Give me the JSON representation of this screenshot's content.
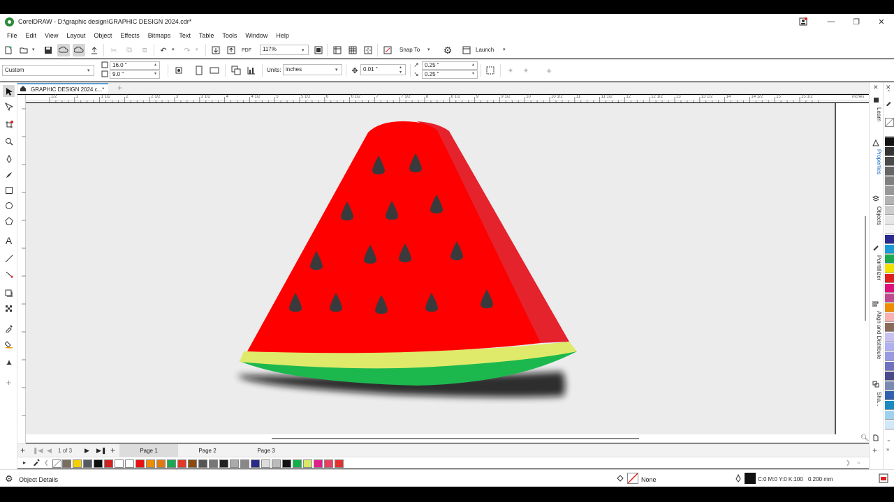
{
  "window": {
    "title": "CorelDRAW - D:\\graphic design\\GRAPHIC DESIGN 2024.cdr*"
  },
  "menu": [
    "File",
    "Edit",
    "View",
    "Layout",
    "Object",
    "Effects",
    "Bitmaps",
    "Text",
    "Table",
    "Tools",
    "Window",
    "Help"
  ],
  "toolbar": {
    "zoom": "117%",
    "snap_label": "Snap To",
    "launch_label": "Launch"
  },
  "propbar": {
    "page_size": "Custom",
    "width": "16.0 \"",
    "height": "9.0 \"",
    "units_label": "Units:",
    "units": "inches",
    "nudge": "0.01 \"",
    "dup_x": "0.25 \"",
    "dup_y": "0.25 \""
  },
  "document": {
    "tab_label": "GRAPHIC DESIGN 2024.c...*"
  },
  "ruler": {
    "top_ticks": [
      "1/2",
      "1",
      "1 1/2",
      "2",
      "2 1/2",
      "3",
      "3 1/2",
      "4",
      "4 1/2",
      "5",
      "5 1/2",
      "6",
      "6 1/2",
      "7",
      "7 1/2",
      "8",
      "8 1/2",
      "9",
      "9 1/2",
      "10",
      "10 1/2",
      "11",
      "11 1/2",
      "12",
      "12 1/2",
      "13",
      "13 1/2",
      "14",
      "14 1/2",
      "15",
      "15 1/2"
    ],
    "units_label": "inches"
  },
  "pages": {
    "counter": "1",
    "of_label": "of",
    "total": "3",
    "tabs": [
      "Page 1",
      "Page 2",
      "Page 3"
    ]
  },
  "palette": [
    "#7a6e5e",
    "#f4d000",
    "#555a62",
    "#0e0e0e",
    "#d32020",
    "#ffffff",
    "#ffffff",
    "#e81010",
    "#f08c00",
    "#e07a10",
    "#1aa850",
    "#e03a2a",
    "#8a4a10",
    "#555555",
    "#777777",
    "#222222",
    "#aaaaaa",
    "#888888",
    "#2a2a8a",
    "#dddddd",
    "#bbbbbb",
    "#111111",
    "#12b04a",
    "#d8e86a",
    "#e0208a",
    "#e84060",
    "#e23030"
  ],
  "vpalette": [
    "#ffffff",
    "#111111",
    "#333333",
    "#4a4a4a",
    "#666666",
    "#808080",
    "#999999",
    "#b3b3b3",
    "#cccccc",
    "#e6e6e6",
    "#f5f5f5",
    "#2a2a90",
    "#1a9ad6",
    "#1aa850",
    "#f4e000",
    "#e02020",
    "#e0107a",
    "#c04a90",
    "#f08c00",
    "#f8b0b0",
    "#8a6a5a",
    "#c8c0f0",
    "#b0b0f0",
    "#9a9ae0",
    "#7070c0",
    "#4a4a8a",
    "#7a8ab0",
    "#3060b0",
    "#1a8ac0",
    "#a0d0f0",
    "#d0e8f8"
  ],
  "docker": [
    "Learn",
    "Properties",
    "Objects",
    "Pointillizer",
    "Align and Distribute",
    "Sha..."
  ],
  "status": {
    "object_details": "Object Details",
    "fill_none": "None",
    "outline_color": "C:0 M:0 Y:0 K:100",
    "outline_width": "0.200 mm"
  },
  "colors": {
    "flesh": "#ff0000",
    "flesh_side": "#e4232d",
    "rind_light": "#dfea6a",
    "rind_green": "#1cb84e",
    "seed": "#3a3a3c",
    "canvas": "#ececec"
  }
}
